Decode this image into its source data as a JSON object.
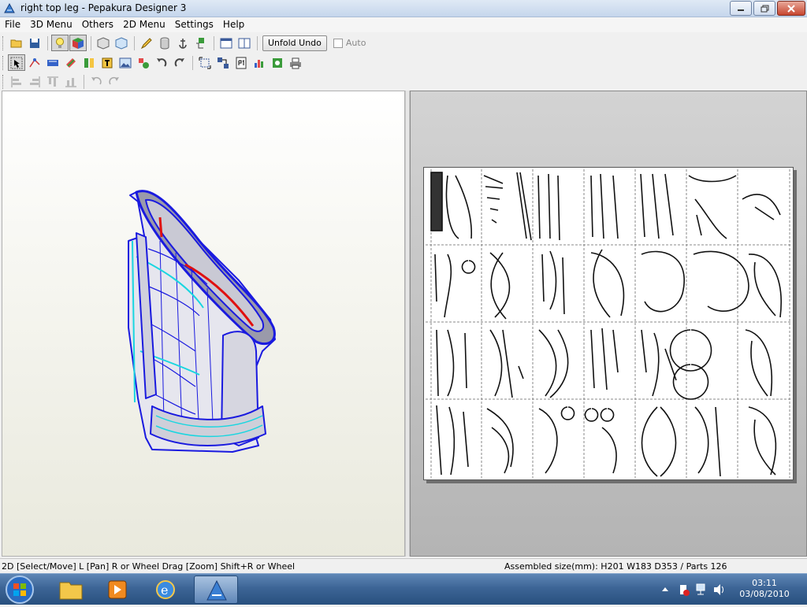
{
  "window": {
    "title": "right top leg - Pepakura Designer 3"
  },
  "menu": [
    "File",
    "3D Menu",
    "Others",
    "2D Menu",
    "Settings",
    "Help"
  ],
  "toolbar": {
    "unfold_undo_label": "Unfold Undo",
    "auto_label": "Auto"
  },
  "statusbar": {
    "left": "2D [Select/Move] L [Pan] R or Wheel Drag [Zoom] Shift+R or Wheel",
    "right": "Assembled size(mm): H201 W183 D353 / Parts 126"
  },
  "taskbar": {
    "time": "03:11",
    "date": "03/08/2010"
  },
  "colors": {
    "wire_blue": "#1a1adf",
    "wire_cyan": "#19d6e0",
    "edge_red": "#e01010",
    "face_grey": "#c9c9d4"
  }
}
